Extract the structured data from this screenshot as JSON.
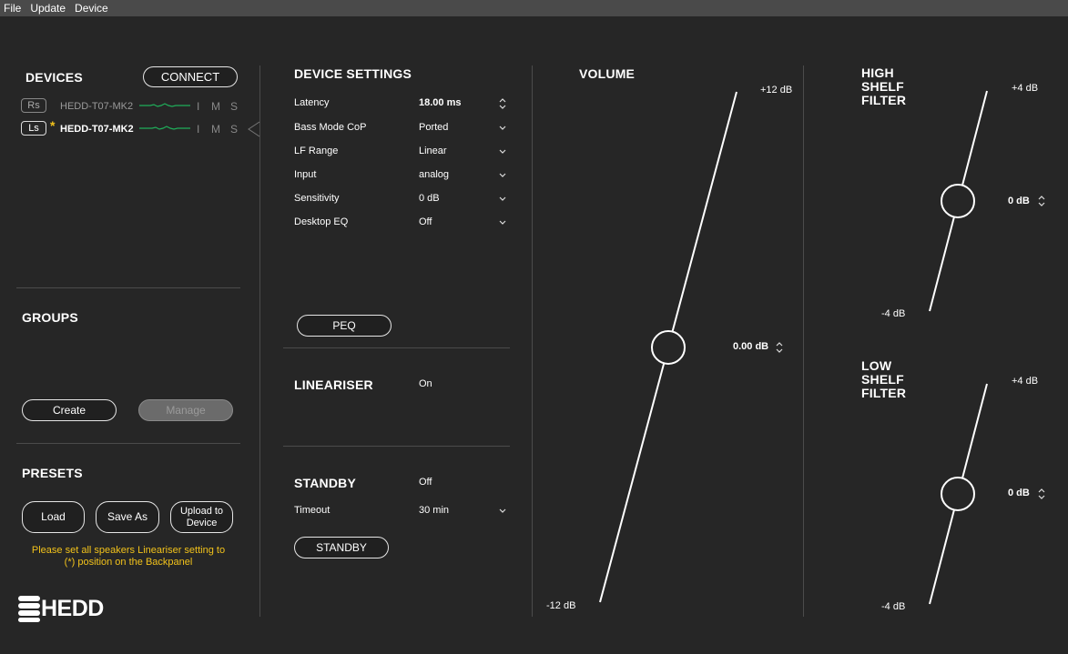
{
  "menu": [
    "File",
    "Update",
    "Device"
  ],
  "devices": {
    "title": "DEVICES",
    "connect_label": "CONNECT",
    "items": [
      {
        "badge": "Rs",
        "name": "HEDD-T07-MK2",
        "flags": [
          "I",
          "M",
          "S"
        ],
        "selected": false,
        "starred": false
      },
      {
        "badge": "Ls",
        "name": "HEDD-T07-MK2",
        "flags": [
          "I",
          "M",
          "S"
        ],
        "selected": true,
        "starred": true
      }
    ],
    "star": "*"
  },
  "groups": {
    "title": "GROUPS",
    "create_label": "Create",
    "manage_label": "Manage"
  },
  "presets": {
    "title": "PRESETS",
    "load_label": "Load",
    "save_as_label": "Save As",
    "upload_label_1": "Upload to",
    "upload_label_2": "Device",
    "warning_1": "Please set all speakers Lineariser setting to",
    "warning_2": "(*) position on the Backpanel"
  },
  "logo_text": "HEDD",
  "device_settings": {
    "title": "DEVICE SETTINGS",
    "rows": [
      {
        "label": "Latency",
        "value": "18.00 ms",
        "control": "stepper"
      },
      {
        "label": "Bass Mode CoP",
        "value": "Ported",
        "control": "dropdown"
      },
      {
        "label": "LF Range",
        "value": "Linear",
        "control": "dropdown"
      },
      {
        "label": "Input",
        "value": "analog",
        "control": "dropdown"
      },
      {
        "label": "Sensitivity",
        "value": "0 dB",
        "control": "dropdown"
      },
      {
        "label": "Desktop EQ",
        "value": "Off",
        "control": "dropdown"
      }
    ],
    "peq_label": "PEQ"
  },
  "lineariser": {
    "title": "LINEARISER",
    "value": "On"
  },
  "standby": {
    "title": "STANDBY",
    "value": "Off",
    "timeout_label": "Timeout",
    "timeout_value": "30 min",
    "button_label": "STANDBY"
  },
  "volume": {
    "title": "VOLUME",
    "max_label": "+12 dB",
    "min_label": "-12 dB",
    "value_label": "0.00 dB",
    "value": 0,
    "min": -12,
    "max": 12
  },
  "high_shelf": {
    "title_1": "HIGH",
    "title_2": "SHELF",
    "title_3": "FILTER",
    "max_label": "+4 dB",
    "min_label": "-4 dB",
    "value_label": "0 dB",
    "value": 0,
    "min": -4,
    "max": 4
  },
  "low_shelf": {
    "title_1": "LOW",
    "title_2": "SHELF",
    "title_3": "FILTER",
    "max_label": "+4 dB",
    "min_label": "-4 dB",
    "value_label": "0 dB",
    "value": 0,
    "min": -4,
    "max": 4
  },
  "colors": {
    "background": "#262626",
    "menubar": "#4a4a4a",
    "meter_green": "#1fae5a",
    "warning": "#f2c21b"
  }
}
